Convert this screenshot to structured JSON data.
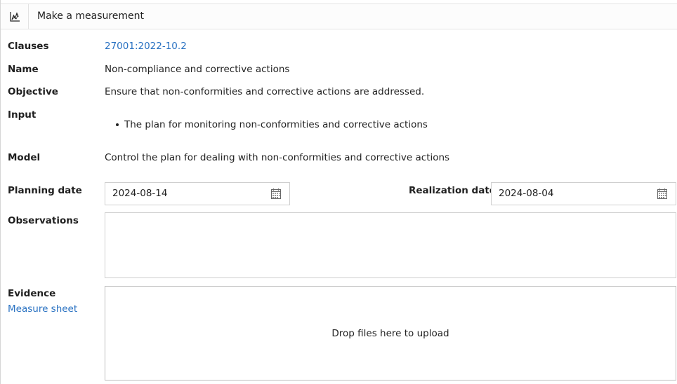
{
  "header": {
    "title": "Make a measurement",
    "icon": "chart-icon"
  },
  "fields": {
    "clauses_label": "Clauses",
    "clauses_value": "27001:2022-10.2",
    "name_label": "Name",
    "name_value": "Non-compliance and corrective actions",
    "objective_label": "Objective",
    "objective_value": "Ensure that non-conformities and corrective actions are addressed.",
    "input_label": "Input",
    "input_items": [
      "The plan for monitoring non-conformities and corrective actions"
    ],
    "model_label": "Model",
    "model_value": "Control the plan for dealing with non-conformities and corrective actions",
    "planning_date_label": "Planning date",
    "planning_date_value": "2024-08-14",
    "realization_date_label": "Realization date",
    "realization_date_value": "2024-08-04",
    "observations_label": "Observations",
    "observations_value": "",
    "evidence_label": "Evidence",
    "measure_sheet_link": "Measure sheet",
    "dropzone_text": "Drop files here to upload"
  },
  "colors": {
    "link": "#2a72c2",
    "border": "#cfcfcf"
  }
}
